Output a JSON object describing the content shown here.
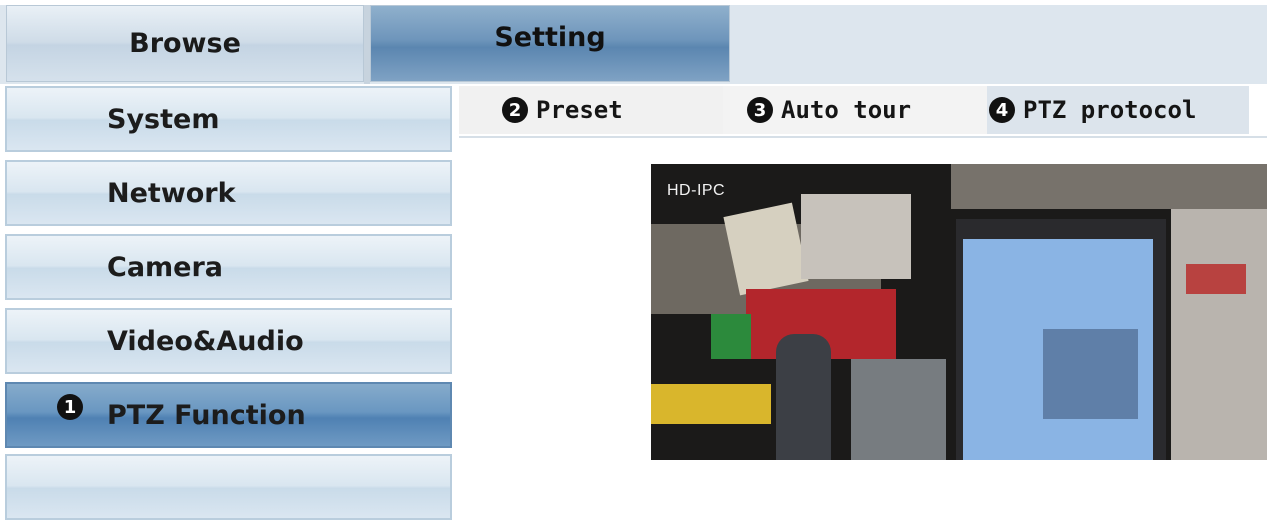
{
  "top_tabs": {
    "browse": "Browse",
    "setting": "Setting"
  },
  "sidebar": {
    "items": [
      {
        "label": "System"
      },
      {
        "label": "Network"
      },
      {
        "label": "Camera"
      },
      {
        "label": "Video&Audio"
      },
      {
        "label": "PTZ Function",
        "badge": "1",
        "active": true
      }
    ]
  },
  "subtabs": [
    {
      "badge": "2",
      "label": "Preset"
    },
    {
      "badge": "3",
      "label": "Auto tour"
    },
    {
      "badge": "4",
      "label": "PTZ protocol"
    }
  ],
  "video": {
    "osd_label": "HD-IPC"
  },
  "colors": {
    "active_tab": "#5b86b0",
    "menu_bg": "#d9e6f0",
    "subtab_highlight": "#dce4ec"
  }
}
